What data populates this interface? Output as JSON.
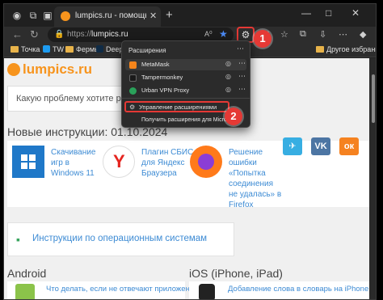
{
  "browser": {
    "tab": {
      "title": "lumpics.ru - помощь с компьют"
    },
    "url": {
      "scheme": "https://",
      "host": "lumpics.ru"
    },
    "read_aloud": "A⁰",
    "bookmarks": [
      {
        "label": "Точка"
      },
      {
        "label": "TW"
      },
      {
        "label": "Фермы"
      },
      {
        "label": "DeepL"
      }
    ],
    "other_bookmarks": "Другое избранное"
  },
  "extensions_popup": {
    "title": "Расширения",
    "items": [
      {
        "name": "MetaMask",
        "color": "#f6851b",
        "active": true
      },
      {
        "name": "Tampermonkey",
        "color": "#1a1a1a",
        "active": false
      },
      {
        "name": "Urban VPN Proxy",
        "color": "#2aa15a",
        "active": false
      }
    ],
    "manage_label": "Управление расширениями",
    "get_label": "Получить расширения для Microsoft"
  },
  "badges": {
    "one": "1",
    "two": "2"
  },
  "page": {
    "logo": "lumpics.ru",
    "search_placeholder": "Какую проблему хотите реш",
    "new_heading": "Новые инструкции: 01.10.2024",
    "articles": [
      {
        "title": "Скачивание игр в Windows 11"
      },
      {
        "title": "Плагин СБИС для Яндекс Браузера"
      },
      {
        "title": "Решение ошибки «Попытка соединения не удалась» в Firefox"
      }
    ],
    "social": [
      {
        "label": "✈",
        "color": "#37aee2"
      },
      {
        "label": "VK",
        "color": "#4c75a3"
      },
      {
        "label": "ок",
        "color": "#f58220"
      }
    ],
    "os_box": "Инструкции по операционным системам",
    "android_heading": "Android",
    "ios_heading": "iOS (iPhone, iPad)",
    "android_item": "Что делать, если не отвечают приложения на",
    "ios_item": "Добавление слова в словарь на iPhone"
  }
}
